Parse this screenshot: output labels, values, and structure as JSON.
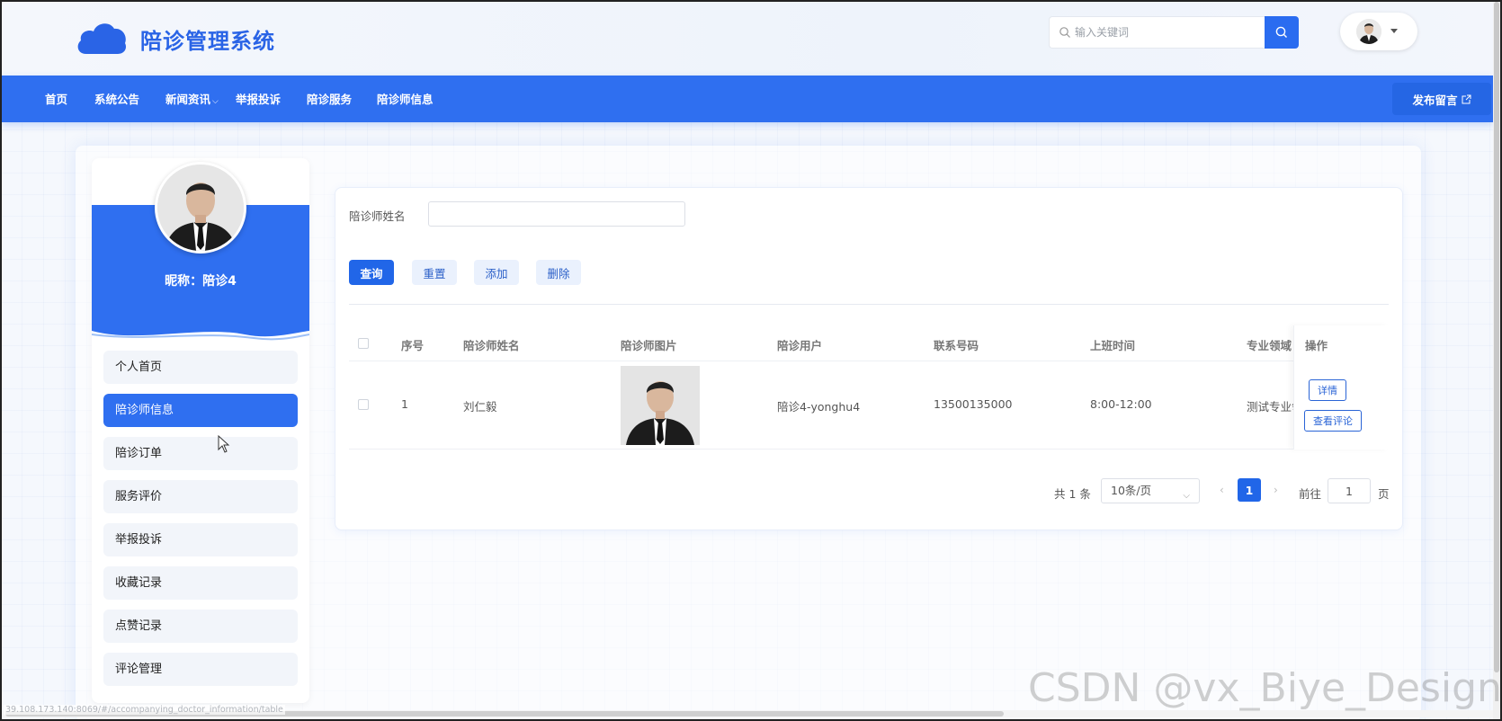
{
  "header": {
    "logo_title": "陪诊管理系统",
    "search_placeholder": "输入关键词"
  },
  "nav": {
    "items": [
      "首页",
      "系统公告",
      "新闻资讯",
      "举报投诉",
      "陪诊服务",
      "陪诊师信息"
    ],
    "publish_label": "发布留言"
  },
  "sidebar": {
    "nickname": "昵称：陪诊4",
    "items": [
      "个人首页",
      "陪诊师信息",
      "陪诊订单",
      "服务评价",
      "举报投诉",
      "收藏记录",
      "点赞记录",
      "评论管理"
    ],
    "active_index": 1
  },
  "filter": {
    "label": "陪诊师姓名",
    "value": ""
  },
  "buttons": {
    "query": "查询",
    "reset": "重置",
    "add": "添加",
    "delete": "删除"
  },
  "table": {
    "headers": [
      "序号",
      "陪诊师姓名",
      "陪诊师图片",
      "陪诊用户",
      "联系号码",
      "上班时间",
      "专业领域",
      "操作"
    ],
    "rows": [
      {
        "index": "1",
        "name": "刘仁毅",
        "user": "陪诊4-yonghu4",
        "phone": "13500135000",
        "work_time": "8:00-12:00",
        "field": "测试专业领域",
        "actions": [
          "详情",
          "查看评论"
        ]
      }
    ]
  },
  "pagination": {
    "total": "共 1 条",
    "page_size": "10条/页",
    "current_page": "1",
    "goto_label": "前往",
    "goto_value": "1",
    "goto_suffix": "页"
  },
  "status_url": "39.108.173.140:8069/#/accompanying_doctor_information/table",
  "watermark": "CSDN @vx_Biye_Design",
  "colors": {
    "primary": "#2f6ff0",
    "button": "#2166e8",
    "light_button": "#eaf1fd"
  }
}
